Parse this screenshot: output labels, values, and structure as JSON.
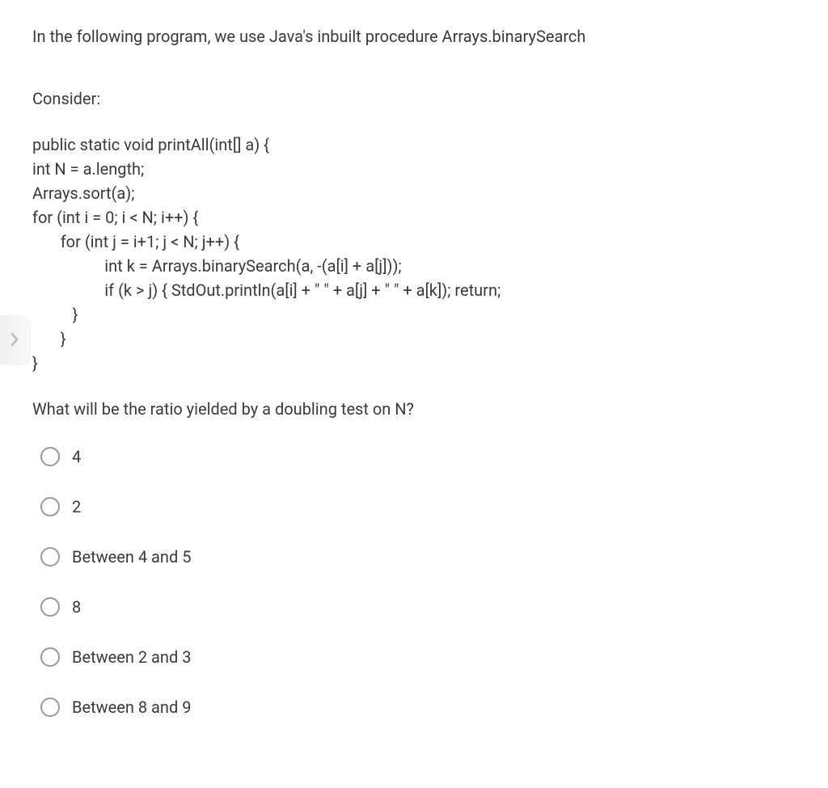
{
  "intro": "In the following program, we use Java's inbuilt procedure Arrays.binarySearch",
  "consider": "Consider:",
  "code": "public static void printAll(int[] a) {\nint N = a.length;\nArrays.sort(a);\nfor (int i = 0; i < N; i++) {\n       for (int j = i+1; j < N; j++) {\n                  int k = Arrays.binarySearch(a, -(a[i] + a[j]));\n                  if (k > j) { StdOut.println(a[i] + \" \" + a[j] + \" \" + a[k]); return;\n          }\n       }\n}",
  "question": "What will be the ratio yielded by a doubling test on N?",
  "options": [
    {
      "label": "4"
    },
    {
      "label": "2"
    },
    {
      "label": "Between 4 and 5"
    },
    {
      "label": "8"
    },
    {
      "label": "Between 2 and 3"
    },
    {
      "label": "Between 8 and 9"
    }
  ]
}
